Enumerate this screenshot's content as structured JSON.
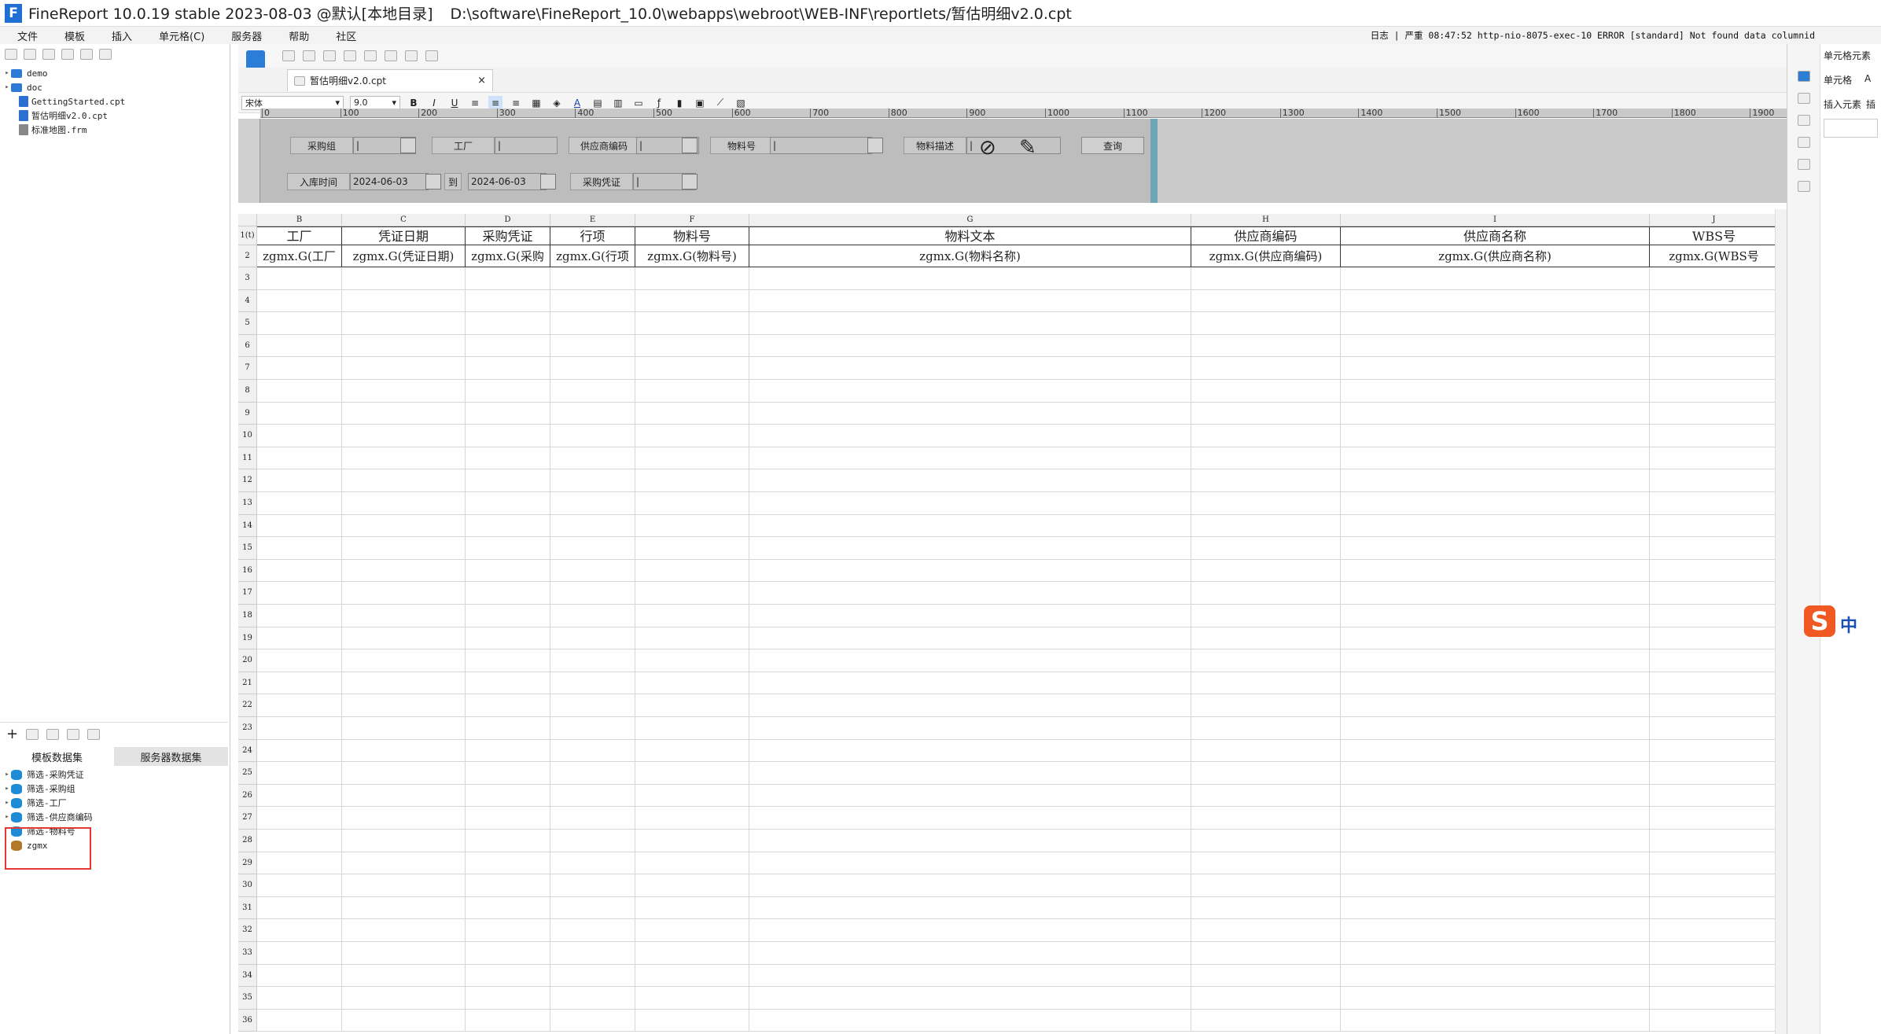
{
  "title": {
    "app": "FineReport 10.0.19 stable 2023-08-03 @默认[本地目录]",
    "path": "D:\\software\\FineReport_10.0\\webapps\\webroot\\WEB-INF\\reportlets/暂估明细v2.0.cpt"
  },
  "menu": [
    "文件",
    "模板",
    "插入",
    "单元格(C)",
    "服务器",
    "帮助",
    "社区"
  ],
  "status_text": "日志 | 严重 08:47:52 http-nio-8075-exec-10 ERROR [standard] Not found data columnid",
  "file_tree": [
    {
      "label": "demo",
      "type": "folder"
    },
    {
      "label": "doc",
      "type": "folder"
    },
    {
      "label": "GettingStarted.cpt",
      "type": "file"
    },
    {
      "label": "暂估明细v2.0.cpt",
      "type": "file"
    },
    {
      "label": "标准地图.frm",
      "type": "file"
    }
  ],
  "ds_tabs": [
    "模板数据集",
    "服务器数据集"
  ],
  "datasets": [
    "筛选-采购凭证",
    "筛选-采购组",
    "筛选-工厂",
    "筛选-供应商编码",
    "筛选-物料号",
    "zgmx"
  ],
  "tab": {
    "label": "暂估明细v2.0.cpt",
    "close": "×"
  },
  "format": {
    "font": "宋体",
    "size": "9.0"
  },
  "ruler": [
    "0",
    "100",
    "200",
    "300",
    "400",
    "500",
    "600",
    "700",
    "800",
    "900",
    "1000",
    "1100",
    "1200",
    "1300",
    "1400",
    "1500",
    "1600",
    "1700",
    "1800",
    "1900"
  ],
  "params": {
    "l_purch_group": "采购组",
    "l_plant": "工厂",
    "l_vendor_code": "供应商编码",
    "l_material_no": "物料号",
    "l_material_desc": "物料描述",
    "l_in_date": "入库时间",
    "date_from": "2024-06-03",
    "l_to": "到",
    "date_to": "2024-06-03",
    "l_purch_doc": "采购凭证",
    "query": "查询"
  },
  "columns": [
    "B",
    "C",
    "D",
    "E",
    "F",
    "G",
    "H",
    "I",
    "J"
  ],
  "header_row": [
    "工厂",
    "凭证日期",
    "采购凭证",
    "行项",
    "物料号",
    "物料文本",
    "供应商编码",
    "供应商名称",
    "WBS号"
  ],
  "template_row": [
    "zgmx.G(工厂",
    "zgmx.G(凭证日期)",
    "zgmx.G(采购",
    "zgmx.G(行项",
    "zgmx.G(物料号)",
    "zgmx.G(物料名称)",
    "zgmx.G(供应商编码)",
    "zgmx.G(供应商名称)",
    "zgmx.G(WBS号"
  ],
  "row_labels": [
    "1(t)",
    "2",
    "3",
    "4",
    "5",
    "6",
    "7",
    "8",
    "9",
    "10",
    "11",
    "12",
    "13",
    "14",
    "15",
    "16",
    "17",
    "18",
    "19",
    "20",
    "21",
    "22",
    "23",
    "24",
    "25",
    "26",
    "27",
    "28",
    "29",
    "30",
    "31",
    "32",
    "33",
    "34",
    "35",
    "36"
  ],
  "right_panel": {
    "tab": "单元格元素",
    "cell": "单元格",
    "cell_val": "A",
    "insert": "插入元素",
    "insert_val": "插"
  },
  "ime": {
    "icon": "S",
    "lang": "中"
  }
}
